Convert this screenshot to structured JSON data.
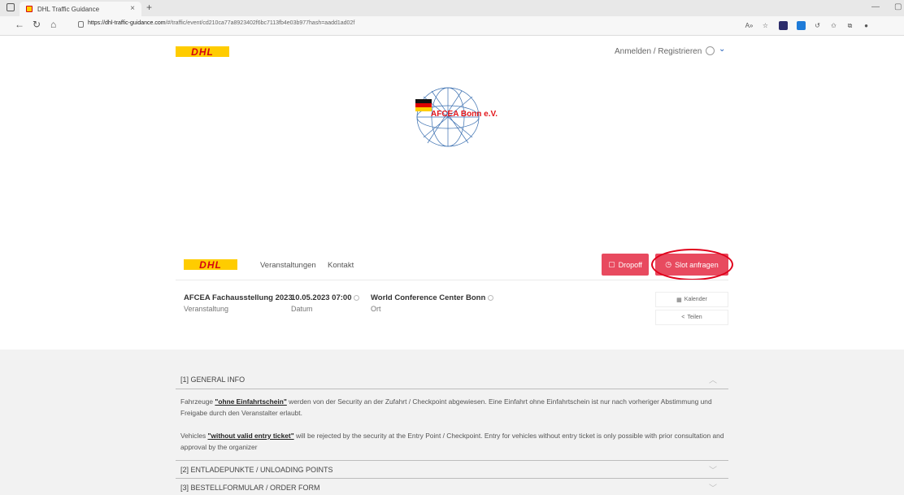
{
  "browser": {
    "tab_title": "DHL Traffic Guidance",
    "url_domain": "https://dhl-traffic-guidance.com",
    "url_path": "/#/traffic/event/cd210ca77a8923402f6bc7113fb4e03b977hash=aadd1ad02f",
    "reader_label": "A»"
  },
  "header": {
    "logo_text": "DHL",
    "login_label": "Anmelden / Registrieren",
    "lang_chevron": "⌄"
  },
  "event_logo": {
    "name": "AFCEA Bonn e.V."
  },
  "event_bar": {
    "logo_text": "DHL",
    "nav": [
      "Veranstaltungen",
      "Kontakt"
    ],
    "dropoff_label": "Dropoff",
    "slot_label": "Slot anfragen"
  },
  "event_meta": {
    "event_name": "AFCEA Fachausstellung 2023",
    "event_label": "Veranstaltung",
    "date_value": "10.05.2023 07:00",
    "date_label": "Datum",
    "location_value": "World Conference Center Bonn",
    "location_label": "Ort",
    "calendar_label": "Kalender",
    "share_label": "Teilen"
  },
  "accordion": {
    "section1_title": "[1] GENERAL INFO",
    "de_prefix": "Fahrzeuge ",
    "de_bold": "\"ohne Einfahrtschein\"",
    "de_rest": " werden von der Security an der Zufahrt / Checkpoint abgewiesen. Eine Einfahrt ohne Einfahrtschein ist nur nach vorheriger Abstimmung und Freigabe durch den Veranstalter erlaubt.",
    "en_prefix": "Vehicles ",
    "en_bold": "\"without valid entry ticket\"",
    "en_rest": " will be rejected by the security at the Entry Point / Checkpoint. Entry for vehicles without entry ticket is only possible with prior consultation and approval by the organizer",
    "section2_title": "[2] ENTLADEPUNKTE / UNLOADING POINTS",
    "section3_title": "[3] BESTELLFORMULAR / ORDER FORM"
  },
  "colors": {
    "dhl_yellow": "#ffcc00",
    "dhl_red": "#d40511",
    "button_pink": "#e84a5f",
    "highlight_red": "#e0001a"
  }
}
